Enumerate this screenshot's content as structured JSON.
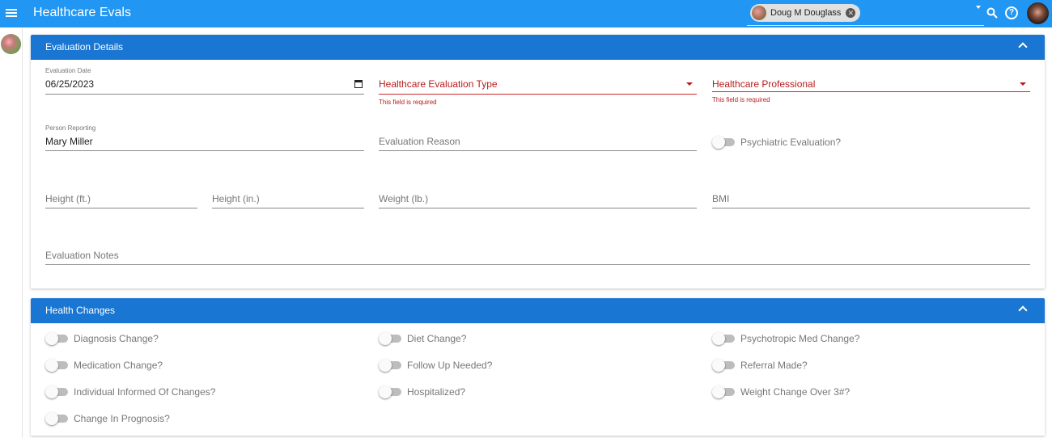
{
  "header": {
    "title": "Healthcare Evals",
    "selected_person": "Doug M Douglass"
  },
  "evaluation_details": {
    "title": "Evaluation Details",
    "evaluation_date": {
      "label": "Evaluation Date",
      "value": "06/25/2023"
    },
    "evaluation_type": {
      "placeholder": "Healthcare Evaluation Type",
      "error": "This field is required"
    },
    "professional": {
      "placeholder": "Healthcare Professional",
      "error": "This field is required"
    },
    "person_reporting": {
      "label": "Person Reporting",
      "value": "Mary Miller"
    },
    "evaluation_reason": {
      "placeholder": "Evaluation Reason"
    },
    "psychiatric_evaluation": {
      "label": "Psychiatric Evaluation?",
      "checked": false
    },
    "height_ft": {
      "placeholder": "Height (ft.)"
    },
    "height_in": {
      "placeholder": "Height (in.)"
    },
    "weight_lb": {
      "placeholder": "Weight (lb.)"
    },
    "bmi": {
      "placeholder": "BMI"
    },
    "notes": {
      "placeholder": "Evaluation Notes"
    }
  },
  "health_changes": {
    "title": "Health Changes",
    "toggles": [
      {
        "label": "Diagnosis Change?",
        "checked": false
      },
      {
        "label": "Diet Change?",
        "checked": false
      },
      {
        "label": "Psychotropic Med Change?",
        "checked": false
      },
      {
        "label": "Medication Change?",
        "checked": false
      },
      {
        "label": "Follow Up Needed?",
        "checked": false
      },
      {
        "label": "Referral Made?",
        "checked": false
      },
      {
        "label": "Individual Informed Of Changes?",
        "checked": false
      },
      {
        "label": "Hospitalized?",
        "checked": false
      },
      {
        "label": "Weight Change Over 3#?",
        "checked": false
      },
      {
        "label": "Change In Prognosis?",
        "checked": false
      }
    ]
  },
  "colors": {
    "topbar": "#2196f3",
    "panel_header": "#1976d2",
    "error": "#b71c1c"
  }
}
